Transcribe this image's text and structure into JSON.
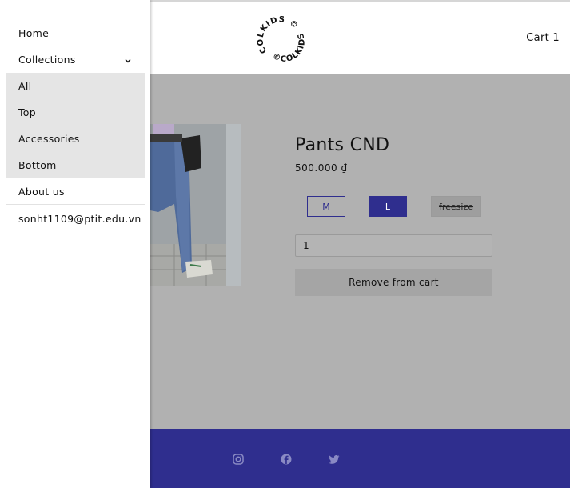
{
  "header": {
    "logo_text": "COLKIDS",
    "cart_label": "Cart 1"
  },
  "product": {
    "title": "Pants CND",
    "price": "500.000 ₫",
    "sizes": [
      {
        "label": "M",
        "state": "available"
      },
      {
        "label": "L",
        "state": "selected"
      },
      {
        "label": "freesize",
        "state": "unavailable"
      }
    ],
    "quantity": "1",
    "remove_label": "Remove from cart"
  },
  "sidebar": {
    "items": [
      {
        "label": "Home"
      },
      {
        "label": "Collections"
      },
      {
        "label": "All"
      },
      {
        "label": "Top"
      },
      {
        "label": "Accessories"
      },
      {
        "label": "Bottom"
      },
      {
        "label": "About us"
      },
      {
        "label": "sonht1109@ptit.edu.vn"
      }
    ]
  },
  "footer": {
    "social_icons": [
      "instagram-icon",
      "facebook-icon",
      "twitter-icon"
    ]
  },
  "colors": {
    "brand": "#2f2e8e",
    "overlay_grey": "#b1b1b1"
  }
}
